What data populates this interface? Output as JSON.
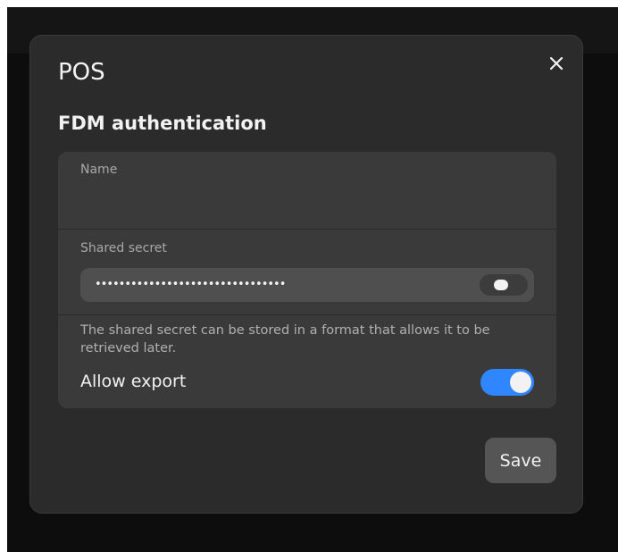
{
  "modal": {
    "title": "POS",
    "subtitle": "FDM authentication"
  },
  "form": {
    "name": {
      "label": "Name",
      "value": ""
    },
    "shared_secret": {
      "label": "Shared secret",
      "masked_value": "••••••••••••••••••••••••••••••••",
      "reveal_toggle_on": false
    },
    "export": {
      "help_text": "The shared secret can be stored in a format that allows it to be retrieved later.",
      "label": "Allow export",
      "enabled": true
    }
  },
  "actions": {
    "save_label": "Save"
  },
  "icons": {
    "close": "close-icon"
  },
  "colors": {
    "accent": "#2f86ff",
    "modal_bg": "#2b2b2b",
    "card_bg": "#3a3a3a",
    "button_bg": "#555555"
  }
}
